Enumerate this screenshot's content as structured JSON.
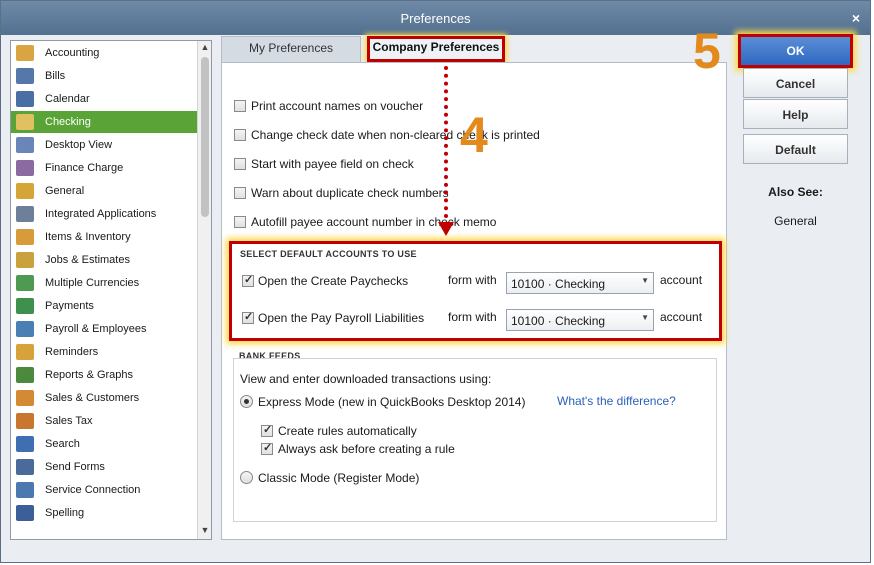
{
  "window": {
    "title": "Preferences",
    "close_label": "×"
  },
  "sidebar": {
    "items": [
      {
        "label": "Accounting",
        "icon": "accounting-icon",
        "color": "#d9a441"
      },
      {
        "label": "Bills",
        "icon": "bills-icon",
        "color": "#5577aa"
      },
      {
        "label": "Calendar",
        "icon": "calendar-icon",
        "color": "#4a6fa5"
      },
      {
        "label": "Checking",
        "icon": "checking-icon",
        "color": "#e0c060"
      },
      {
        "label": "Desktop View",
        "icon": "desktop-view-icon",
        "color": "#6a86b8"
      },
      {
        "label": "Finance Charge",
        "icon": "finance-charge-icon",
        "color": "#8a6aa0"
      },
      {
        "label": "General",
        "icon": "general-icon",
        "color": "#d4a638"
      },
      {
        "label": "Integrated Applications",
        "icon": "integrated-applications-icon",
        "color": "#6d7f99"
      },
      {
        "label": "Items & Inventory",
        "icon": "items-inventory-icon",
        "color": "#d79b3a"
      },
      {
        "label": "Jobs & Estimates",
        "icon": "jobs-estimates-icon",
        "color": "#c9a23e"
      },
      {
        "label": "Multiple Currencies",
        "icon": "multiple-currencies-icon",
        "color": "#4e9a52"
      },
      {
        "label": "Payments",
        "icon": "payments-icon",
        "color": "#3f8f4d"
      },
      {
        "label": "Payroll & Employees",
        "icon": "payroll-employees-icon",
        "color": "#4a7fb4"
      },
      {
        "label": "Reminders",
        "icon": "reminders-icon",
        "color": "#d8a23a"
      },
      {
        "label": "Reports & Graphs",
        "icon": "reports-graphs-icon",
        "color": "#4b8a3c"
      },
      {
        "label": "Sales & Customers",
        "icon": "sales-customers-icon",
        "color": "#d48a34"
      },
      {
        "label": "Sales Tax",
        "icon": "sales-tax-icon",
        "color": "#c9772e"
      },
      {
        "label": "Search",
        "icon": "search-icon",
        "color": "#3f6fb0"
      },
      {
        "label": "Send Forms",
        "icon": "send-forms-icon",
        "color": "#4a6a9a"
      },
      {
        "label": "Service Connection",
        "icon": "service-connection-icon",
        "color": "#4a78b0"
      },
      {
        "label": "Spelling",
        "icon": "spelling-icon",
        "color": "#3c5f9a"
      }
    ],
    "selected": "Checking",
    "selected_color": "#5aa336"
  },
  "tabs": {
    "my": "My Preferences",
    "company": "Company Preferences"
  },
  "options": [
    {
      "label": "Print account names on voucher",
      "checked": false
    },
    {
      "label": "Change check date when non-cleared check is printed",
      "checked": false
    },
    {
      "label": "Start with payee field on check",
      "checked": false
    },
    {
      "label": "Warn about duplicate check numbers",
      "checked": false
    },
    {
      "label": "Autofill payee account number in check memo",
      "checked": false
    }
  ],
  "default_accounts": {
    "heading": "SELECT DEFAULT ACCOUNTS TO USE",
    "rows": [
      {
        "label": "Open the Create Paychecks",
        "checked": true,
        "form_with": "form with",
        "account": "10100 · Checking",
        "suffix": "account"
      },
      {
        "label": "Open the Pay Payroll Liabilities",
        "checked": true,
        "form_with": "form with",
        "account": "10100 · Checking",
        "suffix": "account"
      }
    ]
  },
  "bank_feeds": {
    "heading": "BANK FEEDS",
    "intro": "View and enter downloaded transactions using:",
    "express_label": "Express Mode (new in QuickBooks Desktop 2014)",
    "express_selected": true,
    "difference_link": "What's the difference?",
    "create_rules": "Create rules automatically",
    "create_rules_checked": true,
    "always_ask": "Always ask before creating a rule",
    "always_ask_checked": true,
    "classic_label": "Classic Mode (Register Mode)",
    "classic_selected": false
  },
  "buttons": {
    "ok": "OK",
    "cancel": "Cancel",
    "help": "Help",
    "default": "Default"
  },
  "also_see": {
    "heading": "Also See:",
    "item": "General"
  },
  "annotations": {
    "step4": "4",
    "step5": "5",
    "highlight_color": "#c00000",
    "number_color": "#e38a1c"
  }
}
